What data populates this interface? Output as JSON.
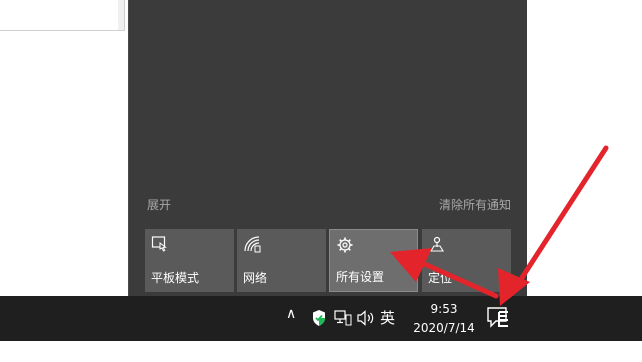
{
  "action_center": {
    "expand_label": "展开",
    "clear_label": "清除所有通知",
    "tiles": [
      {
        "label": "平板模式",
        "icon": "tablet-mode-icon"
      },
      {
        "label": "网络",
        "icon": "network-icon"
      },
      {
        "label": "所有设置",
        "icon": "settings-gear-icon"
      },
      {
        "label": "定位",
        "icon": "location-icon"
      }
    ]
  },
  "taskbar": {
    "ime_label": "英",
    "time": "9:53",
    "date": "2020/7/14"
  },
  "colors": {
    "action_center_bg": "#3b3b3b",
    "tile_bg": "#5a5a5a",
    "taskbar_bg": "#1f1f1f",
    "arrow_red": "#e3242b"
  }
}
